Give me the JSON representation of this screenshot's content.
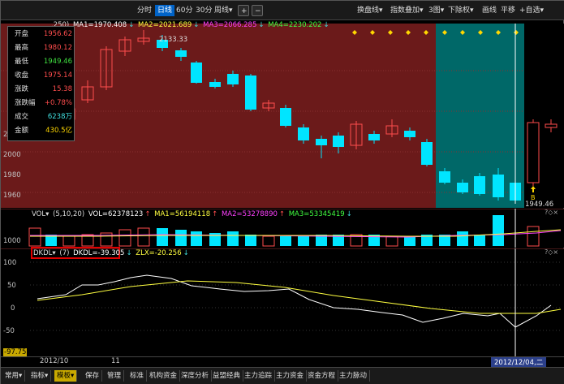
{
  "toolbar": {
    "left_buttons": [
      "分时",
      "日线",
      "60分",
      "30分",
      "周线▾",
      "+",
      "−"
    ],
    "active": "日线",
    "right_buttons": [
      "换盘线▾",
      "指数叠加▾",
      "3图▾",
      "下除权▾",
      "画线",
      "平移",
      "+自选▾"
    ]
  },
  "ohlc_panel": {
    "rows": [
      {
        "label": "开盘",
        "value": "1956.62",
        "color": "#ff4d4d"
      },
      {
        "label": "最高",
        "value": "1980.12",
        "color": "#ff4d4d"
      },
      {
        "label": "最低",
        "value": "1949.46",
        "color": "#40e040"
      },
      {
        "label": "收盘",
        "value": "1975.14",
        "color": "#ff4d4d"
      },
      {
        "label": "涨跌",
        "value": "15.38",
        "color": "#ff4d4d"
      },
      {
        "label": "涨跌幅",
        "value": "+0.78%",
        "color": "#ff4d4d"
      },
      {
        "label": "成交",
        "value": "6238万",
        "color": "#40e0e0"
      },
      {
        "label": "金额",
        "value": "430.5亿",
        "color": "#ffd700"
      }
    ]
  },
  "price_legend": {
    "prefix": ",250)",
    "items": [
      {
        "text": "MA1=1970.408",
        "arrow": "↓",
        "color": "#ffffff"
      },
      {
        "text": "MA2=2021.689",
        "arrow": "↓",
        "color": "#ffff40"
      },
      {
        "text": "MA3=2066.285",
        "arrow": "↓",
        "color": "#ff40ff"
      },
      {
        "text": "MA4=2230.202",
        "arrow": "↓",
        "color": "#40ff40"
      }
    ]
  },
  "price_axis": [
    "2020",
    "2000",
    "1980",
    "1960"
  ],
  "price_annotations": {
    "high": "2133.33",
    "low": "1949.46",
    "signal": "B"
  },
  "vol_legend": {
    "name": "VOL▾",
    "params": "(5,10,20)",
    "items": [
      {
        "text": "VOL=62378123",
        "arrow": "↑",
        "color": "#ffffff"
      },
      {
        "text": "MA1=56194118",
        "arrow": "↑",
        "color": "#ffff40"
      },
      {
        "text": "MA2=53278890",
        "arrow": "↑",
        "color": "#ff40ff"
      },
      {
        "text": "MA3=53345419",
        "arrow": "↓",
        "color": "#40ff40"
      }
    ]
  },
  "vol_axis": "1000",
  "ind_legend": {
    "name": "DKDL▾",
    "params": "(7)",
    "items": [
      {
        "text": "DKDL=-39.305",
        "arrow": "↓",
        "color": "#ffffff"
      },
      {
        "text": "ZLX=-20.256",
        "arrow": "↓",
        "color": "#ffff40"
      }
    ]
  },
  "ind_axis": [
    "100",
    "50",
    "0",
    "-50",
    "-97.75"
  ],
  "time_axis": {
    "left": "2012/10",
    "mid": "11",
    "cursor": "2012/12/04,二"
  },
  "bottom_tabs": [
    "常用▾",
    "指标▾",
    "模板▾",
    "保存",
    "管理",
    "标准",
    "机构资金",
    "深度分析",
    "益盟经典",
    "主力追踪",
    "主力资金",
    "资金方程",
    "主力脉动"
  ],
  "active_tab": "模板▾",
  "colors": {
    "up": "#ff4d4d",
    "down": "#00e5ff",
    "bg_price": "#6b1a1a",
    "highlight": "#006868"
  }
}
